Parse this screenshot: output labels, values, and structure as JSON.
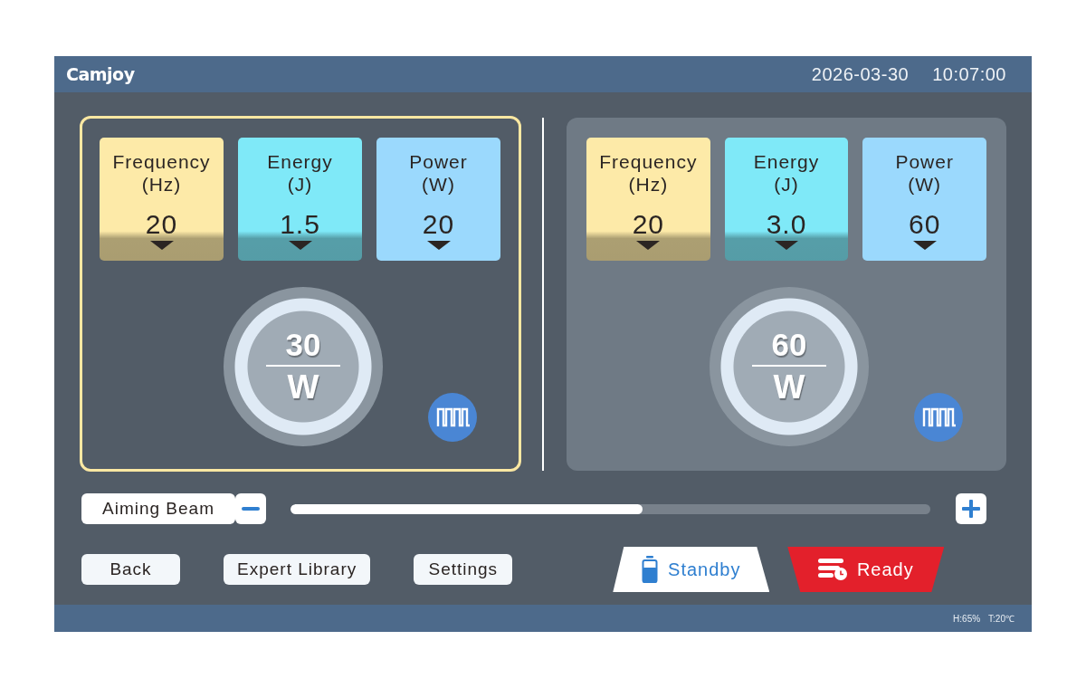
{
  "header": {
    "logo": "Camjoy",
    "date": "2026-03-30",
    "time": "10:07:00"
  },
  "panels": [
    {
      "selected": true,
      "tiles": [
        {
          "label": "Frequency",
          "unit": "(Hz)",
          "value": "20",
          "color": "#fdeaa8",
          "shaded": true
        },
        {
          "label": "Energy",
          "unit": "(J)",
          "value": "1.5",
          "color": "#7fe9f8",
          "shaded": true
        },
        {
          "label": "Power",
          "unit": "(W)",
          "value": "20",
          "color": "#9bd9fd",
          "shaded": false
        }
      ],
      "dial": {
        "value": "30",
        "unit": "W"
      }
    },
    {
      "selected": false,
      "tiles": [
        {
          "label": "Frequency",
          "unit": "(Hz)",
          "value": "20",
          "color": "#fdeaa8",
          "shaded": true
        },
        {
          "label": "Energy",
          "unit": "(J)",
          "value": "3.0",
          "color": "#7fe9f8",
          "shaded": true
        },
        {
          "label": "Power",
          "unit": "(W)",
          "value": "60",
          "color": "#9bd9fd",
          "shaded": false
        }
      ],
      "dial": {
        "value": "60",
        "unit": "W"
      }
    }
  ],
  "aiming_beam": {
    "label": "Aiming Beam",
    "level": 0.55
  },
  "nav_buttons": [
    "Back",
    "Expert Library",
    "Settings"
  ],
  "mode_buttons": [
    {
      "label": "Standby",
      "kind": "standby"
    },
    {
      "label": "Ready",
      "kind": "ready"
    }
  ],
  "status_bar": {
    "humidity": "H:65%",
    "temperature": "T:20℃"
  }
}
